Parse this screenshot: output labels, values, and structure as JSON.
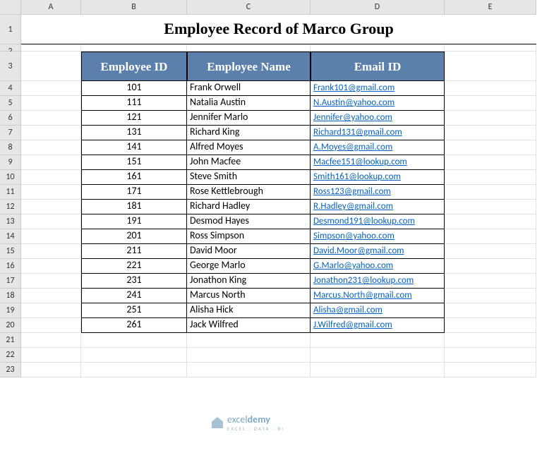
{
  "columns": [
    "A",
    "B",
    "C",
    "D",
    "E"
  ],
  "row_nums": [
    1,
    2,
    3,
    4,
    5,
    6,
    7,
    8,
    9,
    10,
    11,
    12,
    13,
    14,
    15,
    16,
    17,
    18,
    19,
    20,
    21,
    22,
    23
  ],
  "title": "Employee Record of Marco Group",
  "headers": {
    "id": "Employee ID",
    "name": "Employee Name",
    "email": "Email ID"
  },
  "rows": [
    {
      "id": "101",
      "name": "Frank Orwell",
      "email": "Frank101@gmail.com"
    },
    {
      "id": "111",
      "name": "Natalia Austin",
      "email": "N.Austin@yahoo.com"
    },
    {
      "id": "121",
      "name": "Jennifer Marlo",
      "email": "Jennifer@yahoo.com"
    },
    {
      "id": "131",
      "name": "Richard King",
      "email": "Richard131@gmail.com"
    },
    {
      "id": "141",
      "name": "Alfred Moyes",
      "email": "A.Moyes@gmail.com"
    },
    {
      "id": "151",
      "name": "John Macfee",
      "email": "Macfee151@lookup.com"
    },
    {
      "id": "161",
      "name": "Steve Smith",
      "email": "Smith161@lookup.com"
    },
    {
      "id": "171",
      "name": "Rose Kettlebrough",
      "email": "Ross123@gmail.com"
    },
    {
      "id": "181",
      "name": "Richard Hadley",
      "email": "R.Hadley@gmail.com"
    },
    {
      "id": "191",
      "name": "Desmod Hayes",
      "email": "Desmond191@lookup.com"
    },
    {
      "id": "201",
      "name": "Ross Simpson",
      "email": "Simpson@yahoo.com"
    },
    {
      "id": "211",
      "name": "David Moor",
      "email": "David.Moor@gmail.com"
    },
    {
      "id": "221",
      "name": "George Marlo",
      "email": "G.Marlo@yahoo.com"
    },
    {
      "id": "231",
      "name": "Jonathon King",
      "email": "Jonathon231@lookup.com"
    },
    {
      "id": "241",
      "name": "Marcus North",
      "email": "Marcus.North@gmail.com"
    },
    {
      "id": "251",
      "name": "Alisha Hick",
      "email": "Alisha@gmail.com"
    },
    {
      "id": "261",
      "name": "Jack Wilfred",
      "email": "J.Wilfred@gmail.com"
    }
  ],
  "logo": {
    "brand_a": "excel",
    "brand_b": "demy",
    "tag": "EXCEL · DATA · BI"
  }
}
